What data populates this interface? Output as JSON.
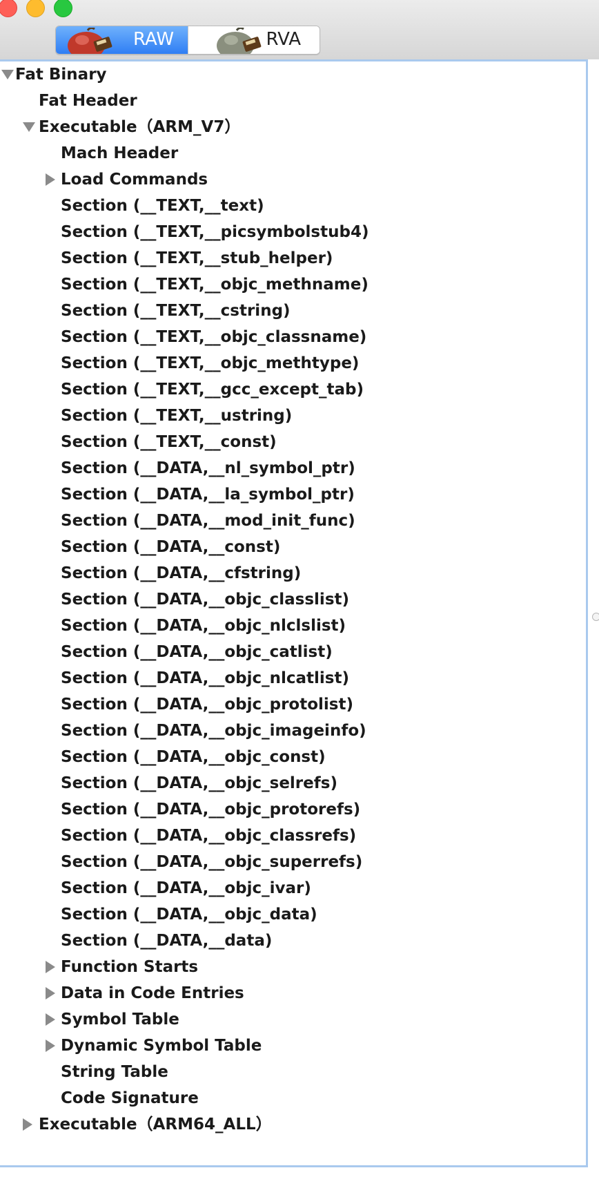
{
  "window": {
    "segments": [
      {
        "label": "RAW",
        "icon": "apple-disk-icon",
        "active": true
      },
      {
        "label": "RVA",
        "icon": "gray-disk-icon",
        "active": false
      }
    ]
  },
  "tree": [
    {
      "label": "Fat Binary",
      "level": 0,
      "state": "expanded"
    },
    {
      "label": "Fat Header",
      "level": 1,
      "state": "leaf"
    },
    {
      "label": "Executable（ARM_V7）",
      "level": 1,
      "state": "expanded"
    },
    {
      "label": "Mach Header",
      "level": 2,
      "state": "leaf"
    },
    {
      "label": "Load Commands",
      "level": 2,
      "state": "collapsed"
    },
    {
      "label": "Section (__TEXT,__text)",
      "level": 2,
      "state": "leaf"
    },
    {
      "label": "Section (__TEXT,__picsymbolstub4)",
      "level": 2,
      "state": "leaf"
    },
    {
      "label": "Section (__TEXT,__stub_helper)",
      "level": 2,
      "state": "leaf"
    },
    {
      "label": "Section (__TEXT,__objc_methname)",
      "level": 2,
      "state": "leaf"
    },
    {
      "label": "Section (__TEXT,__cstring)",
      "level": 2,
      "state": "leaf"
    },
    {
      "label": "Section (__TEXT,__objc_classname)",
      "level": 2,
      "state": "leaf"
    },
    {
      "label": "Section (__TEXT,__objc_methtype)",
      "level": 2,
      "state": "leaf"
    },
    {
      "label": "Section (__TEXT,__gcc_except_tab)",
      "level": 2,
      "state": "leaf"
    },
    {
      "label": "Section (__TEXT,__ustring)",
      "level": 2,
      "state": "leaf"
    },
    {
      "label": "Section (__TEXT,__const)",
      "level": 2,
      "state": "leaf"
    },
    {
      "label": "Section (__DATA,__nl_symbol_ptr)",
      "level": 2,
      "state": "leaf"
    },
    {
      "label": "Section (__DATA,__la_symbol_ptr)",
      "level": 2,
      "state": "leaf"
    },
    {
      "label": "Section (__DATA,__mod_init_func)",
      "level": 2,
      "state": "leaf"
    },
    {
      "label": "Section (__DATA,__const)",
      "level": 2,
      "state": "leaf"
    },
    {
      "label": "Section (__DATA,__cfstring)",
      "level": 2,
      "state": "leaf"
    },
    {
      "label": "Section (__DATA,__objc_classlist)",
      "level": 2,
      "state": "leaf"
    },
    {
      "label": "Section (__DATA,__objc_nlclslist)",
      "level": 2,
      "state": "leaf"
    },
    {
      "label": "Section (__DATA,__objc_catlist)",
      "level": 2,
      "state": "leaf"
    },
    {
      "label": "Section (__DATA,__objc_nlcatlist)",
      "level": 2,
      "state": "leaf"
    },
    {
      "label": "Section (__DATA,__objc_protolist)",
      "level": 2,
      "state": "leaf"
    },
    {
      "label": "Section (__DATA,__objc_imageinfo)",
      "level": 2,
      "state": "leaf"
    },
    {
      "label": "Section (__DATA,__objc_const)",
      "level": 2,
      "state": "leaf"
    },
    {
      "label": "Section (__DATA,__objc_selrefs)",
      "level": 2,
      "state": "leaf"
    },
    {
      "label": "Section (__DATA,__objc_protorefs)",
      "level": 2,
      "state": "leaf"
    },
    {
      "label": "Section (__DATA,__objc_classrefs)",
      "level": 2,
      "state": "leaf"
    },
    {
      "label": "Section (__DATA,__objc_superrefs)",
      "level": 2,
      "state": "leaf"
    },
    {
      "label": "Section (__DATA,__objc_ivar)",
      "level": 2,
      "state": "leaf"
    },
    {
      "label": "Section (__DATA,__objc_data)",
      "level": 2,
      "state": "leaf"
    },
    {
      "label": "Section (__DATA,__data)",
      "level": 2,
      "state": "leaf"
    },
    {
      "label": "Function Starts",
      "level": 2,
      "state": "collapsed"
    },
    {
      "label": "Data in Code Entries",
      "level": 2,
      "state": "collapsed"
    },
    {
      "label": "Symbol Table",
      "level": 2,
      "state": "collapsed"
    },
    {
      "label": "Dynamic Symbol Table",
      "level": 2,
      "state": "collapsed"
    },
    {
      "label": "String Table",
      "level": 2,
      "state": "leaf"
    },
    {
      "label": "Code Signature",
      "level": 2,
      "state": "leaf"
    },
    {
      "label": "Executable（ARM64_ALL）",
      "level": 1,
      "state": "collapsed"
    }
  ]
}
